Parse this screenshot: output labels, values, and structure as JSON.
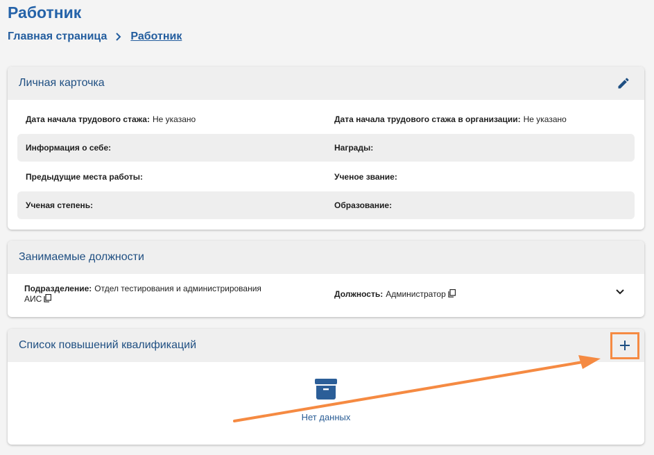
{
  "page": {
    "title": "Работник",
    "breadcrumb": {
      "home": "Главная страница",
      "current": "Работник"
    }
  },
  "personal_card": {
    "title": "Личная карточка",
    "rows": [
      {
        "left_label": "Дата начала трудового стажа:",
        "left_value": "Не указано",
        "right_label": "Дата начала трудового стажа в организации:",
        "right_value": "Не указано"
      },
      {
        "left_label": "Информация о себе:",
        "left_value": "",
        "right_label": "Награды:",
        "right_value": ""
      },
      {
        "left_label": "Предыдущие места работы:",
        "left_value": "",
        "right_label": "Ученое звание:",
        "right_value": ""
      },
      {
        "left_label": "Ученая степень:",
        "left_value": "",
        "right_label": "Образование:",
        "right_value": ""
      }
    ]
  },
  "positions": {
    "title": "Занимаемые должности",
    "department_label": "Подразделение:",
    "department_value_line1": "Отдел тестирования и администрирования",
    "department_value_line2": "АИС",
    "position_label": "Должность:",
    "position_value": "Администратор"
  },
  "qualifications": {
    "title": "Список повышений квалификаций",
    "empty_text": "Нет данных"
  },
  "colors": {
    "accent": "#2563a9",
    "annotation": "#f58a42",
    "header_bg": "#efefef"
  }
}
